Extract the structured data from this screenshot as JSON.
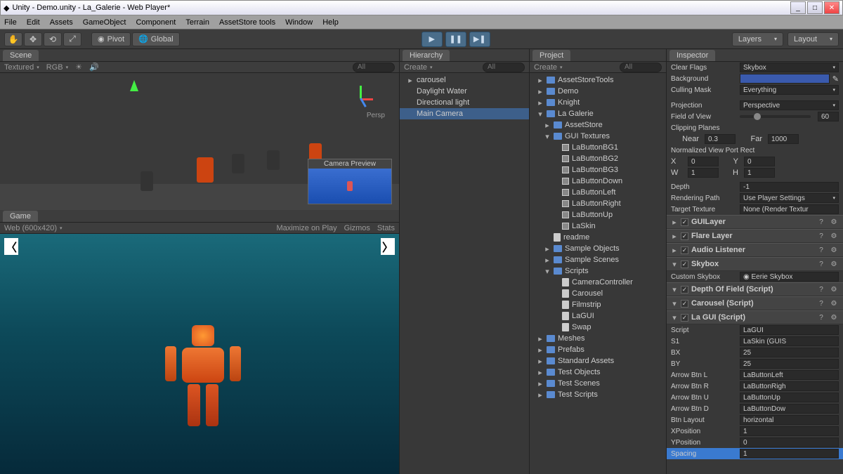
{
  "title": "Unity - Demo.unity - La_Galerie - Web Player*",
  "menu": [
    "File",
    "Edit",
    "Assets",
    "GameObject",
    "Component",
    "Terrain",
    "AssetStore tools",
    "Window",
    "Help"
  ],
  "toolbar": {
    "pivot": "Pivot",
    "global": "Global",
    "layers": "Layers",
    "layout": "Layout"
  },
  "scene": {
    "tab": "Scene",
    "textured": "Textured",
    "rgb": "RGB",
    "search": "All",
    "persp": "Persp",
    "cam_preview": "Camera Preview"
  },
  "game": {
    "tab": "Game",
    "res": "Web (600x420)",
    "maximize": "Maximize on Play",
    "gizmos": "Gizmos",
    "stats": "Stats"
  },
  "hierarchy": {
    "tab": "Hierarchy",
    "create": "Create",
    "search": "All",
    "items": [
      "carousel",
      "Daylight Water",
      "Directional light",
      "Main Camera"
    ]
  },
  "project": {
    "tab": "Project",
    "create": "Create",
    "search": "All",
    "tree": [
      {
        "t": "AssetStoreTools",
        "f": true,
        "i": 0,
        "exp": false
      },
      {
        "t": "Demo",
        "f": true,
        "i": 0
      },
      {
        "t": "Knight",
        "f": true,
        "i": 0,
        "exp": false
      },
      {
        "t": "La Galerie",
        "f": true,
        "i": 0,
        "exp": true
      },
      {
        "t": "AssetStore",
        "f": true,
        "i": 1,
        "exp": false
      },
      {
        "t": "GUI Textures",
        "f": true,
        "i": 1,
        "exp": true
      },
      {
        "t": "LaButtonBG1",
        "x": true,
        "i": 2
      },
      {
        "t": "LaButtonBG2",
        "x": true,
        "i": 2
      },
      {
        "t": "LaButtonBG3",
        "x": true,
        "i": 2
      },
      {
        "t": "LaButtonDown",
        "x": true,
        "i": 2
      },
      {
        "t": "LaButtonLeft",
        "x": true,
        "i": 2
      },
      {
        "t": "LaButtonRight",
        "x": true,
        "i": 2
      },
      {
        "t": "LaButtonUp",
        "x": true,
        "i": 2
      },
      {
        "t": "LaSkin",
        "x": true,
        "i": 2
      },
      {
        "t": "readme",
        "i": 1
      },
      {
        "t": "Sample Objects",
        "f": true,
        "i": 1,
        "exp": false
      },
      {
        "t": "Sample Scenes",
        "f": true,
        "i": 1,
        "exp": false
      },
      {
        "t": "Scripts",
        "f": true,
        "i": 1,
        "exp": true
      },
      {
        "t": "CameraController",
        "i": 2
      },
      {
        "t": "Carousel",
        "i": 2
      },
      {
        "t": "Filmstrip",
        "i": 2
      },
      {
        "t": "LaGUI",
        "i": 2
      },
      {
        "t": "Swap",
        "i": 2
      },
      {
        "t": "Meshes",
        "f": true,
        "i": 0,
        "exp": false
      },
      {
        "t": "Prefabs",
        "f": true,
        "i": 0,
        "exp": false
      },
      {
        "t": "Standard Assets",
        "f": true,
        "i": 0,
        "exp": false
      },
      {
        "t": "Test Objects",
        "f": true,
        "i": 0,
        "exp": false
      },
      {
        "t": "Test Scenes",
        "f": true,
        "i": 0,
        "exp": false
      },
      {
        "t": "Test Scripts",
        "f": true,
        "i": 0,
        "exp": false
      }
    ]
  },
  "inspector": {
    "tab": "Inspector",
    "clear_flags": "Clear Flags",
    "clear_flags_v": "Skybox",
    "background": "Background",
    "culling": "Culling Mask",
    "culling_v": "Everything",
    "projection": "Projection",
    "projection_v": "Perspective",
    "fov": "Field of View",
    "fov_v": "60",
    "clipping": "Clipping Planes",
    "near": "Near",
    "near_v": "0.3",
    "far": "Far",
    "far_v": "1000",
    "normrect": "Normalized View Port Rect",
    "x": "X",
    "x_v": "0",
    "y": "Y",
    "y_v": "0",
    "w": "W",
    "w_v": "1",
    "h": "H",
    "h_v": "1",
    "depth": "Depth",
    "depth_v": "-1",
    "rendpath": "Rendering Path",
    "rendpath_v": "Use Player Settings",
    "targettex": "Target Texture",
    "targettex_v": "None (Render Textur",
    "comps": [
      "GUILayer",
      "Flare Layer",
      "Audio Listener",
      "Skybox",
      "Depth Of Field (Script)",
      "Carousel (Script)",
      "La GUI (Script)"
    ],
    "skybox_custom": "Custom Skybox",
    "skybox_v": "Eerie Skybox",
    "lagui": {
      "script": "Script",
      "script_v": "LaGUI",
      "s1": "S1",
      "s1_v": "LaSkin (GUIS",
      "bx": "BX",
      "bx_v": "25",
      "by": "BY",
      "by_v": "25",
      "abl": "Arrow Btn L",
      "abl_v": "LaButtonLeft",
      "abr": "Arrow Btn R",
      "abr_v": "LaButtonRigh",
      "abu": "Arrow Btn U",
      "abu_v": "LaButtonUp",
      "abd": "Arrow Btn D",
      "abd_v": "LaButtonDow",
      "layout": "Btn Layout",
      "layout_v": "horizontal",
      "xpos": "XPosition",
      "xpos_v": "1",
      "ypos": "YPosition",
      "ypos_v": "0",
      "spacing": "Spacing",
      "spacing_v": "1"
    }
  }
}
